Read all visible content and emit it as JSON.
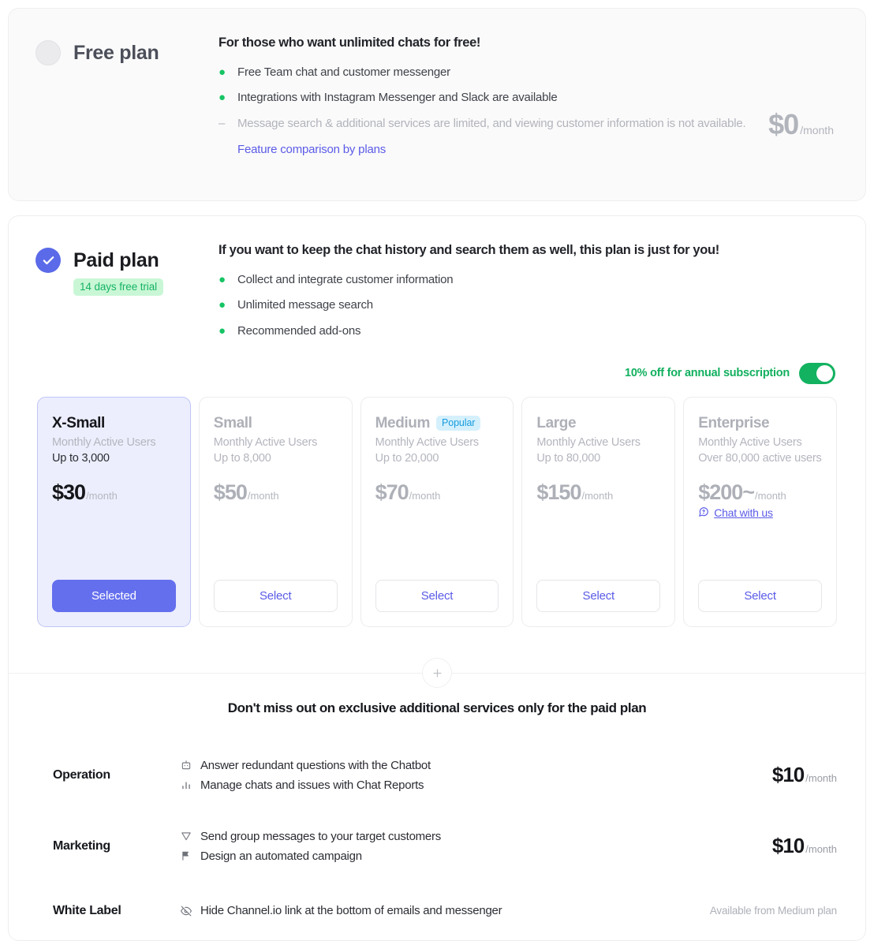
{
  "free_plan": {
    "title": "Free plan",
    "radio_state": "unselected",
    "tagline": "For those who want unlimited chats for free!",
    "features": [
      {
        "marker": "dot",
        "text": "Free Team chat and customer messenger",
        "muted": false
      },
      {
        "marker": "dot",
        "text": "Integrations with Instagram Messenger and Slack are available",
        "muted": false
      },
      {
        "marker": "dash",
        "text": "Message search & additional services are limited, and viewing customer information is not available.",
        "muted": true
      }
    ],
    "link_label": "Feature comparison by plans",
    "price": {
      "amount": "$0",
      "period": "/month"
    }
  },
  "paid_plan": {
    "title": "Paid plan",
    "radio_state": "selected",
    "trial_badge": "14 days free trial",
    "tagline": "If you want to keep the chat history and search them as well, this plan is just for you!",
    "features": [
      {
        "marker": "dot",
        "text": "Collect and integrate customer information"
      },
      {
        "marker": "dot",
        "text": "Unlimited message search"
      },
      {
        "marker": "dot",
        "text": "Recommended add-ons"
      }
    ],
    "annual_toggle": {
      "label": "10% off for annual subscription",
      "state": "on"
    },
    "tiers": [
      {
        "name": "X-Small",
        "badge": null,
        "subtitle": "Monthly Active Users",
        "capacity": "Up to 3,000",
        "price_amount": "$30",
        "price_period": "/month",
        "contact_link": null,
        "button_label": "Selected",
        "selected": true
      },
      {
        "name": "Small",
        "badge": null,
        "subtitle": "Monthly Active Users",
        "capacity": "Up to 8,000",
        "price_amount": "$50",
        "price_period": "/month",
        "contact_link": null,
        "button_label": "Select",
        "selected": false
      },
      {
        "name": "Medium",
        "badge": "Popular",
        "subtitle": "Monthly Active Users",
        "capacity": "Up to 20,000",
        "price_amount": "$70",
        "price_period": "/month",
        "contact_link": null,
        "button_label": "Select",
        "selected": false
      },
      {
        "name": "Large",
        "badge": null,
        "subtitle": "Monthly Active Users",
        "capacity": "Up to 80,000",
        "price_amount": "$150",
        "price_period": "/month",
        "contact_link": null,
        "button_label": "Select",
        "selected": false
      },
      {
        "name": "Enterprise",
        "badge": null,
        "subtitle": "Monthly Active Users",
        "capacity": "Over 80,000 active users",
        "price_amount": "$200~",
        "price_period": "/month",
        "contact_link": "Chat with us",
        "button_label": "Select",
        "selected": false
      }
    ]
  },
  "addons": {
    "expand_icon": "plus-icon",
    "title": "Don't miss out on exclusive additional services only for the paid plan",
    "rows": [
      {
        "category": "Operation",
        "items": [
          {
            "icon": "chatbot-icon",
            "text": "Answer redundant questions with the Chatbot"
          },
          {
            "icon": "bar-chart-icon",
            "text": "Manage chats and issues with Chat Reports"
          }
        ],
        "price_amount": "$10",
        "price_period": "/month",
        "note": null
      },
      {
        "category": "Marketing",
        "items": [
          {
            "icon": "send-icon",
            "text": "Send group messages to your target customers"
          },
          {
            "icon": "flag-icon",
            "text": "Design an automated campaign"
          }
        ],
        "price_amount": "$10",
        "price_period": "/month",
        "note": null
      },
      {
        "category": "White Label",
        "items": [
          {
            "icon": "eye-off-icon",
            "text": "Hide Channel.io link at the bottom of emails and messenger"
          }
        ],
        "price_amount": null,
        "price_period": null,
        "note": "Available from Medium plan"
      }
    ]
  },
  "colors": {
    "accent_indigo": "#5b5be8",
    "selected_button": "#646fee",
    "green": "#16c464",
    "popular_blue": "#169bde",
    "muted_gray": "#b2b4bc"
  }
}
